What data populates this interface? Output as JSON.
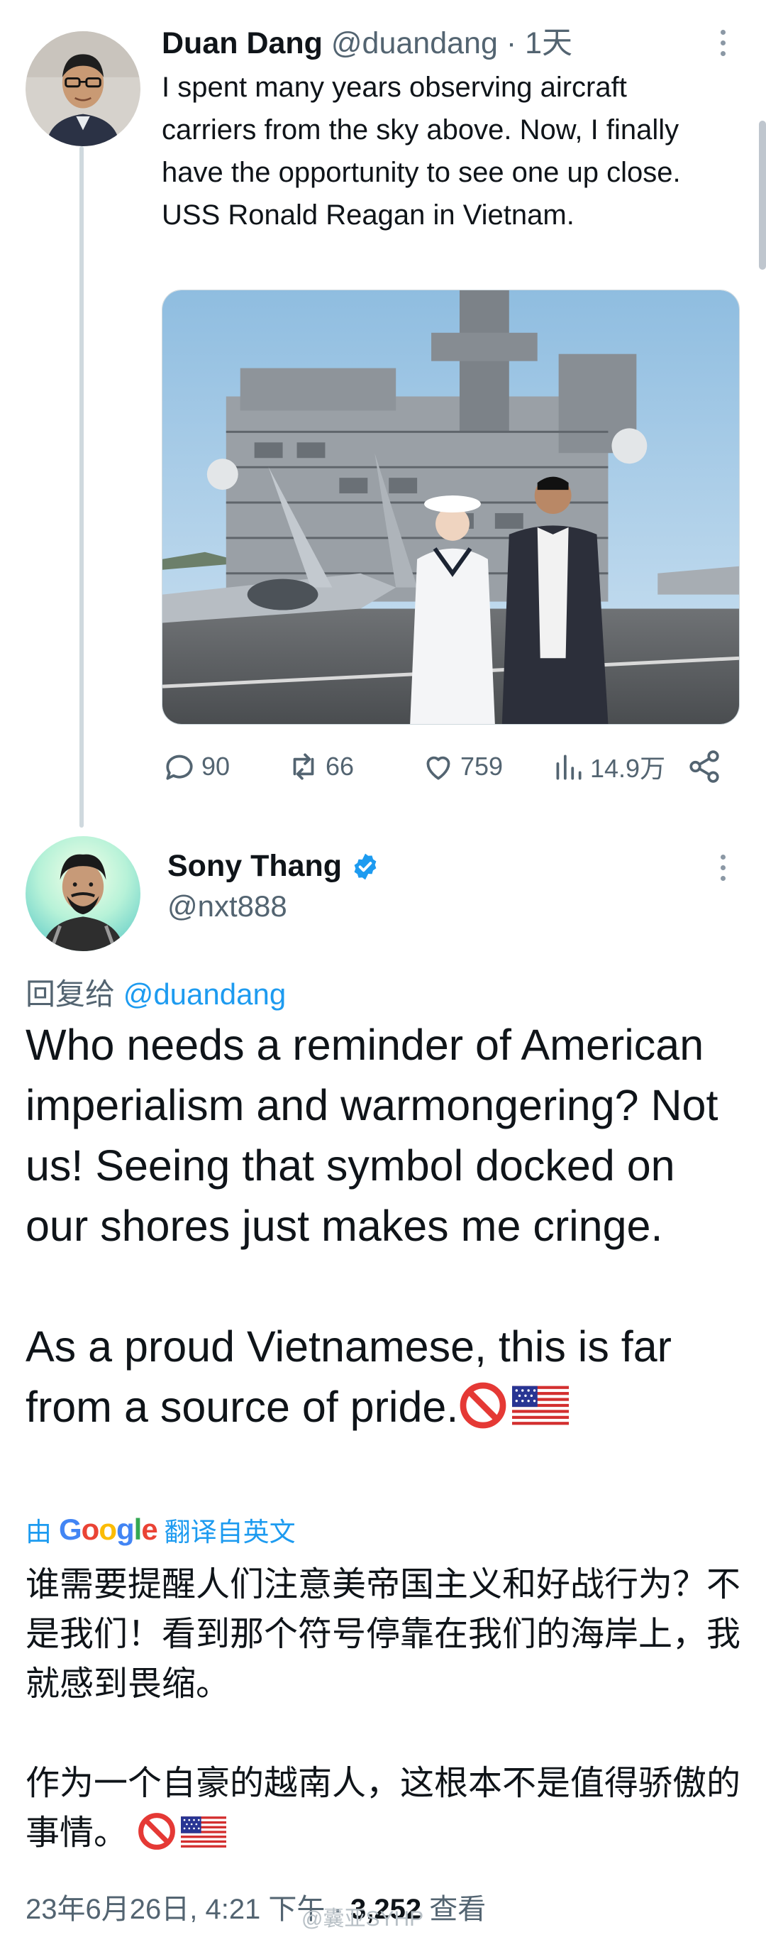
{
  "tweet1": {
    "name": "Duan Dang",
    "handle": "@duandang",
    "time": "· 1天",
    "text": "I spent many years observing aircraft carriers from the sky above. Now, I finally have the opportunity to see one up close. USS Ronald Reagan in Vietnam.",
    "stats": {
      "replies": "90",
      "retweets": "66",
      "likes": "759",
      "views": "14.9万"
    }
  },
  "tweet2": {
    "name": "Sony Thang",
    "handle": "@nxt888",
    "reply_prefix": "回复给",
    "reply_handle": "@duandang",
    "para1": "Who needs a reminder of American imperialism and warmongering? Not us! Seeing that symbol docked on our shores just makes me cringe.",
    "para2": "As a proud Vietnamese, this is far from a source of pride.",
    "translate_prefix": "由",
    "translate_brand": "Google",
    "translate_suffix": "翻译自英文",
    "trans1": "谁需要提醒人们注意美帝国主义和好战行为？不是我们！看到那个符号停靠在我们的海岸上，我就感到畏缩。",
    "trans2": "作为一个自豪的越南人，这根本不是值得骄傲的事情。",
    "footer_date": "23年6月26日, 4:21 下午 ·",
    "footer_views": "3,252",
    "footer_views_label": "查看"
  },
  "watermark": "@囊亚SYHP",
  "icons": {
    "reply": "speech-bubble-icon",
    "retweet": "retweet-arrows-icon",
    "like": "heart-icon",
    "views": "bar-chart-icon",
    "share": "share-icon",
    "verified": "verified-badge-icon",
    "menu": "more-vertical-icon"
  },
  "colors": {
    "accent": "#1d9bf0",
    "muted": "#536471",
    "text": "#0f1419"
  }
}
